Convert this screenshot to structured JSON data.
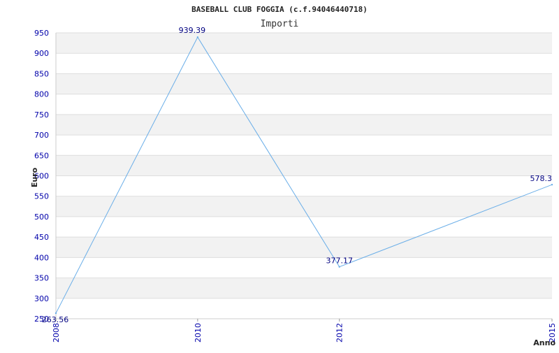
{
  "chart_data": {
    "type": "line",
    "title": "BASEBALL CLUB FOGGIA (c.f.94046440718)",
    "subtitle": "Importi",
    "xlabel": "Anno",
    "ylabel": "Euro",
    "x": [
      "2008",
      "2010",
      "2012",
      "2015"
    ],
    "series": [
      {
        "values": [
          263.56,
          939.39,
          377.17,
          578.3
        ]
      }
    ],
    "data_labels": [
      "263.56",
      "939.39",
      "377.17",
      "578.3"
    ],
    "ylim": [
      250,
      950
    ],
    "y_ticks": [
      250,
      300,
      350,
      400,
      450,
      500,
      550,
      600,
      650,
      700,
      750,
      800,
      850,
      900,
      950
    ],
    "grid": true,
    "colors": {
      "line": "#6aaee8",
      "band": "#f2f2f2",
      "grid": "#dddddd",
      "tick_text": "#0000aa",
      "label_text": "#000080"
    }
  }
}
